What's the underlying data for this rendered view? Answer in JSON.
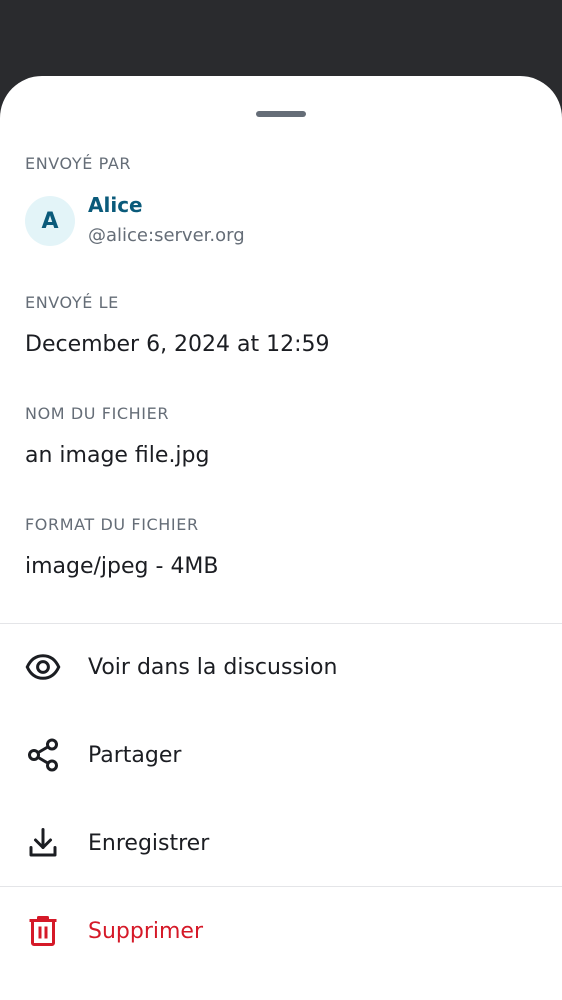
{
  "sheet": {
    "sent_by": {
      "label": "ENVOYÉ PAR",
      "avatar_letter": "A",
      "name": "Alice",
      "user_id": "@alice:server.org"
    },
    "sent_on": {
      "label": "ENVOYÉ LE",
      "value": "December 6, 2024 at 12:59"
    },
    "file_name": {
      "label": "NOM DU FICHIER",
      "value": "an image file.jpg"
    },
    "file_format": {
      "label": "FORMAT DU FICHIER",
      "value": "image/jpeg - 4MB"
    }
  },
  "actions": [
    {
      "label": "Voir dans la discussion",
      "icon": "eye-icon"
    },
    {
      "label": "Partager",
      "icon": "share-icon"
    },
    {
      "label": "Enregistrer",
      "icon": "download-icon"
    },
    {
      "label": "Supprimer",
      "icon": "trash-icon"
    }
  ],
  "colors": {
    "backdrop": "#2a2b2e",
    "accent": "#0a5a7a",
    "avatar_bg": "#e3f4f8",
    "secondary_text": "#656d77",
    "danger": "#d51928"
  }
}
